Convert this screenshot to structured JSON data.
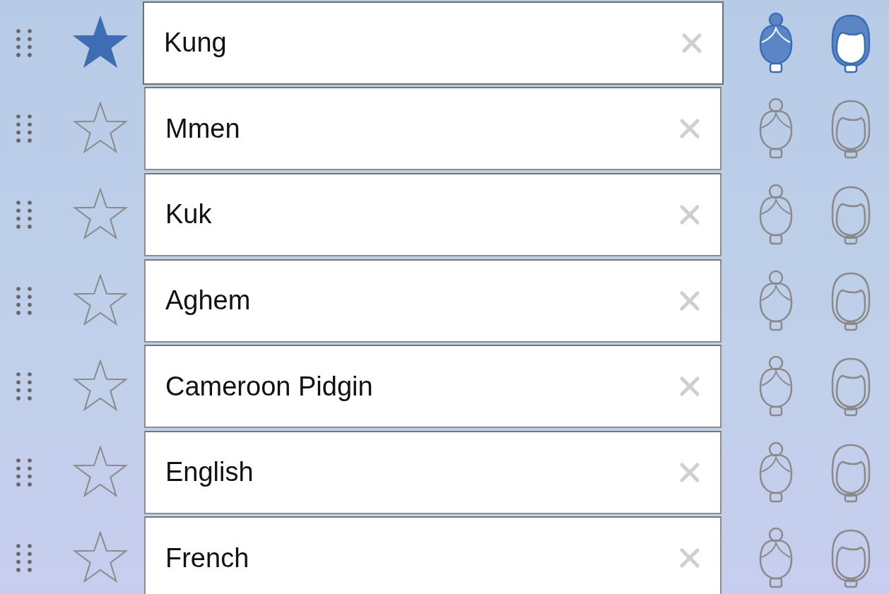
{
  "languages": [
    {
      "name": "Kung",
      "favorite": true,
      "active": true,
      "female_selected": true,
      "male_selected": true
    },
    {
      "name": "Mmen",
      "favorite": false,
      "active": false,
      "female_selected": false,
      "male_selected": false
    },
    {
      "name": "Kuk",
      "favorite": false,
      "active": false,
      "female_selected": false,
      "male_selected": false
    },
    {
      "name": "Aghem",
      "favorite": false,
      "active": false,
      "female_selected": false,
      "male_selected": false
    },
    {
      "name": "Cameroon Pidgin",
      "favorite": false,
      "active": false,
      "female_selected": false,
      "male_selected": false
    },
    {
      "name": "English",
      "favorite": false,
      "active": false,
      "female_selected": false,
      "male_selected": false
    },
    {
      "name": "French",
      "favorite": false,
      "active": false,
      "female_selected": false,
      "male_selected": false
    }
  ]
}
